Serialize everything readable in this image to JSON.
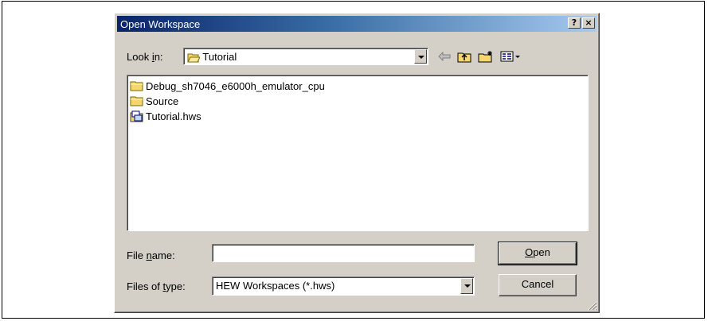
{
  "dialog": {
    "title": "Open Workspace",
    "help_button": "?",
    "close_button": "×"
  },
  "lookin": {
    "label_pre": "Look ",
    "label_accel": "i",
    "label_post": "n:",
    "value": "Tutorial"
  },
  "toolbar": {
    "back_icon": "back-arrow-icon",
    "up_icon": "up-folder-icon",
    "new_folder_icon": "new-folder-icon",
    "view_icon": "view-menu-icon"
  },
  "files": [
    {
      "name": "Debug_sh7046_e6000h_emulator_cpu",
      "type": "folder"
    },
    {
      "name": "Source",
      "type": "folder"
    },
    {
      "name": "Tutorial.hws",
      "type": "workspace"
    }
  ],
  "filename": {
    "label_pre": "File ",
    "label_accel": "n",
    "label_post": "ame:",
    "value": ""
  },
  "filetype": {
    "label_pre": "Files of ",
    "label_accel": "t",
    "label_post": "ype:",
    "value": "HEW Workspaces (*.hws)"
  },
  "buttons": {
    "open_accel": "O",
    "open_rest": "pen",
    "cancel": "Cancel"
  },
  "colors": {
    "titlebar_start": "#0a246a",
    "titlebar_end": "#a6caf0",
    "face": "#d4d0c8",
    "folder": "#f5d76e"
  }
}
